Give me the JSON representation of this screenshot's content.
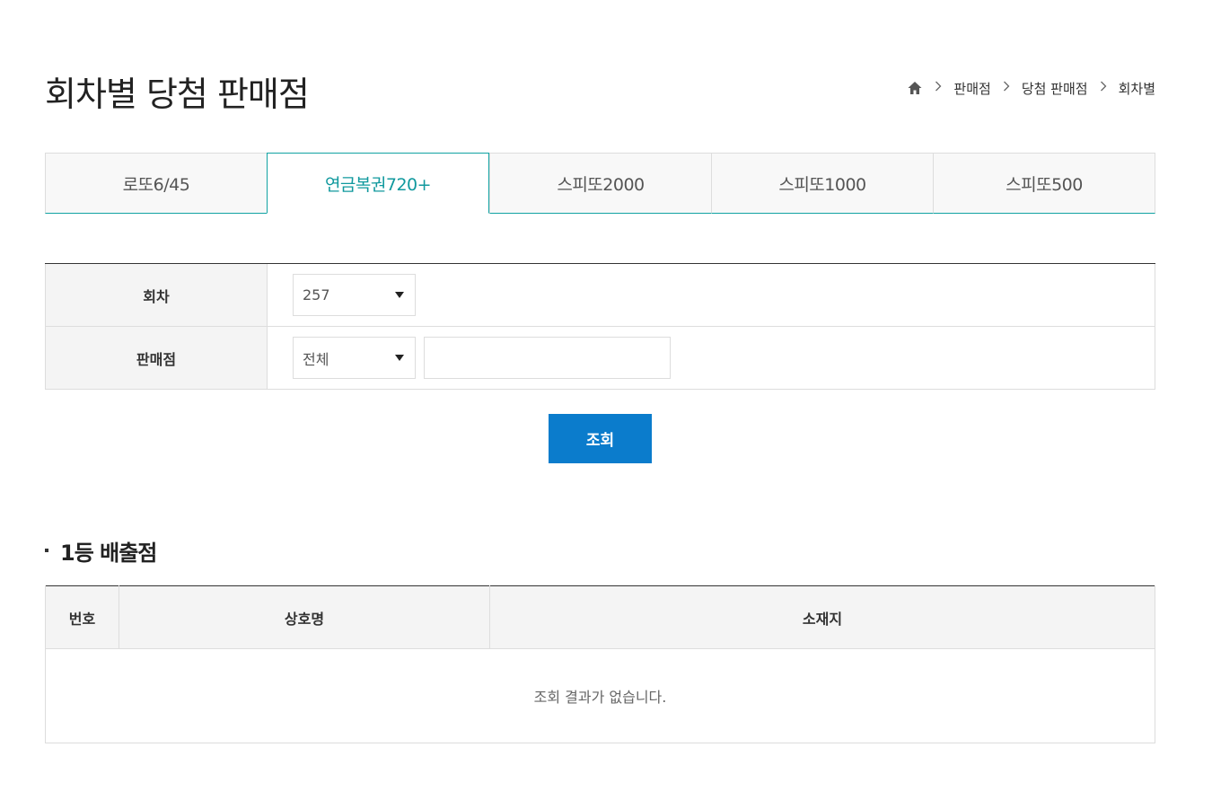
{
  "page": {
    "title": "회차별 당첨 판매점"
  },
  "breadcrumb": {
    "home_icon": "home-icon",
    "items": [
      "판매점",
      "당첨 판매점",
      "회차별"
    ]
  },
  "tabs": [
    {
      "label": "로또6/45",
      "active": false
    },
    {
      "label": "연금복권720+",
      "active": true
    },
    {
      "label": "스피또2000",
      "active": false
    },
    {
      "label": "스피또1000",
      "active": false
    },
    {
      "label": "스피또500",
      "active": false
    }
  ],
  "search": {
    "round_label": "회차",
    "round_value": "257",
    "store_label": "판매점",
    "store_filter_value": "전체",
    "store_keyword_value": "",
    "submit_label": "조회"
  },
  "results": {
    "section_title": "1등 배출점",
    "columns": [
      "번호",
      "상호명",
      "소재지"
    ],
    "empty_message": "조회 결과가 없습니다."
  },
  "colors": {
    "accent_teal": "#11999e",
    "button_blue": "#0b7ccc"
  }
}
